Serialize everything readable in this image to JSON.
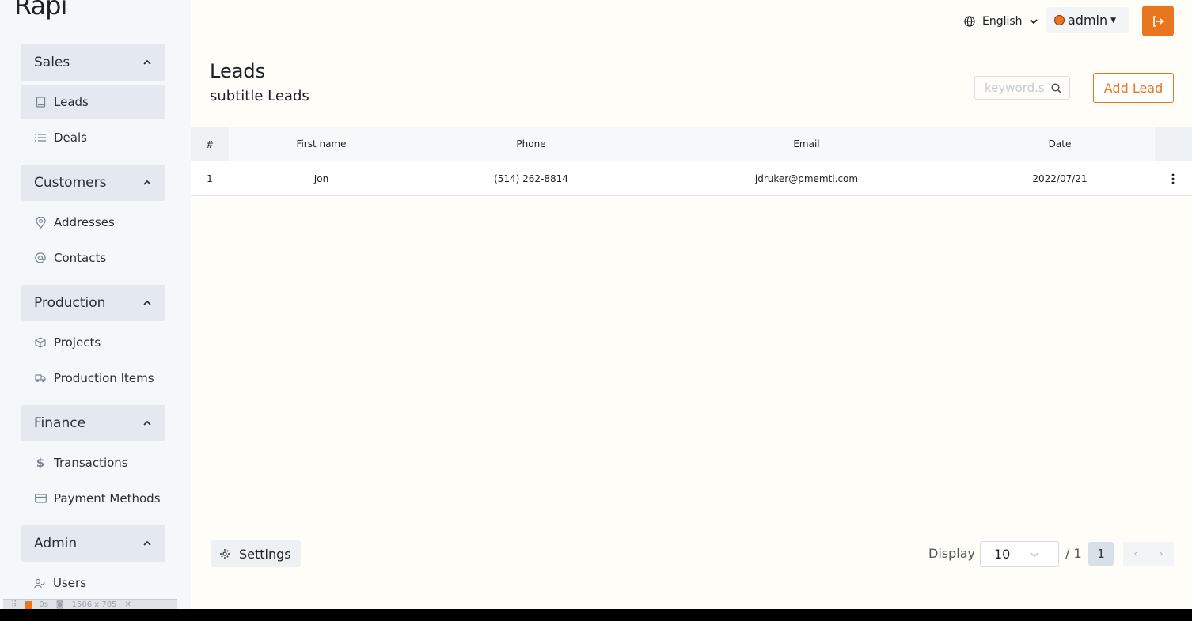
{
  "app": {
    "logo_text": "Rapi"
  },
  "sidebar": {
    "groups": [
      {
        "label": "Sales",
        "items": [
          {
            "label": "Leads",
            "icon": "book-icon",
            "active": true
          },
          {
            "label": "Deals",
            "icon": "list-icon"
          }
        ]
      },
      {
        "label": "Customers",
        "items": [
          {
            "label": "Addresses",
            "icon": "map-pin-icon"
          },
          {
            "label": "Contacts",
            "icon": "at-icon"
          }
        ]
      },
      {
        "label": "Production",
        "items": [
          {
            "label": "Projects",
            "icon": "box-icon"
          },
          {
            "label": "Production Items",
            "icon": "truck-icon"
          }
        ]
      },
      {
        "label": "Finance",
        "items": [
          {
            "label": "Transactions",
            "icon": "dollar-icon"
          },
          {
            "label": "Payment Methods",
            "icon": "credit-card-icon"
          }
        ]
      },
      {
        "label": "Admin",
        "items": [
          {
            "label": "Users",
            "icon": "users-icon"
          }
        ]
      }
    ]
  },
  "topbar": {
    "language": "English",
    "user": "admin",
    "logout_icon": "logout-icon"
  },
  "page": {
    "title": "Leads",
    "subtitle": "subtitle Leads",
    "search_placeholder": "keyword.s",
    "add_button": "Add Lead"
  },
  "table": {
    "columns": [
      "#",
      "First name",
      "Phone",
      "Email",
      "Date"
    ],
    "rows": [
      [
        "1",
        "Jon",
        "(514) 262-8814",
        "jdruker@pmemtl.com",
        "2022/07/21"
      ]
    ]
  },
  "footer": {
    "settings_label": "Settings",
    "display_label": "Display",
    "page_size": "10",
    "total_pages": "/ 1",
    "current_page": "1",
    "prev": "‹",
    "next": "›"
  },
  "devbar": {
    "timer": "0s",
    "size": "1506 x 785"
  },
  "colors": {
    "accent": "#e8761f",
    "sidebar_bg": "#f4f8fb",
    "group_bg": "#e3e9ef"
  }
}
